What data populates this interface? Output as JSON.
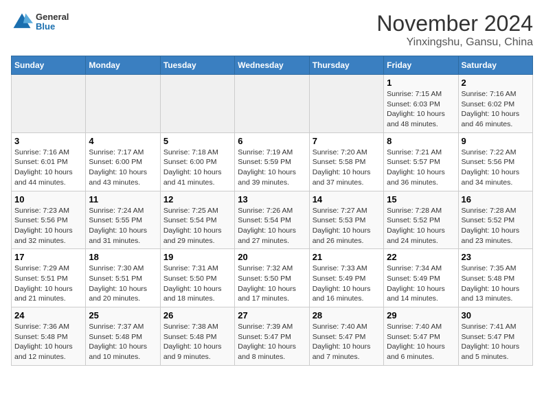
{
  "header": {
    "logo_general": "General",
    "logo_blue": "Blue",
    "title": "November 2024",
    "subtitle": "Yinxingshu, Gansu, China"
  },
  "weekdays": [
    "Sunday",
    "Monday",
    "Tuesday",
    "Wednesday",
    "Thursday",
    "Friday",
    "Saturday"
  ],
  "weeks": [
    [
      {
        "day": "",
        "info": ""
      },
      {
        "day": "",
        "info": ""
      },
      {
        "day": "",
        "info": ""
      },
      {
        "day": "",
        "info": ""
      },
      {
        "day": "",
        "info": ""
      },
      {
        "day": "1",
        "info": "Sunrise: 7:15 AM\nSunset: 6:03 PM\nDaylight: 10 hours and 48 minutes."
      },
      {
        "day": "2",
        "info": "Sunrise: 7:16 AM\nSunset: 6:02 PM\nDaylight: 10 hours and 46 minutes."
      }
    ],
    [
      {
        "day": "3",
        "info": "Sunrise: 7:16 AM\nSunset: 6:01 PM\nDaylight: 10 hours and 44 minutes."
      },
      {
        "day": "4",
        "info": "Sunrise: 7:17 AM\nSunset: 6:00 PM\nDaylight: 10 hours and 43 minutes."
      },
      {
        "day": "5",
        "info": "Sunrise: 7:18 AM\nSunset: 6:00 PM\nDaylight: 10 hours and 41 minutes."
      },
      {
        "day": "6",
        "info": "Sunrise: 7:19 AM\nSunset: 5:59 PM\nDaylight: 10 hours and 39 minutes."
      },
      {
        "day": "7",
        "info": "Sunrise: 7:20 AM\nSunset: 5:58 PM\nDaylight: 10 hours and 37 minutes."
      },
      {
        "day": "8",
        "info": "Sunrise: 7:21 AM\nSunset: 5:57 PM\nDaylight: 10 hours and 36 minutes."
      },
      {
        "day": "9",
        "info": "Sunrise: 7:22 AM\nSunset: 5:56 PM\nDaylight: 10 hours and 34 minutes."
      }
    ],
    [
      {
        "day": "10",
        "info": "Sunrise: 7:23 AM\nSunset: 5:56 PM\nDaylight: 10 hours and 32 minutes."
      },
      {
        "day": "11",
        "info": "Sunrise: 7:24 AM\nSunset: 5:55 PM\nDaylight: 10 hours and 31 minutes."
      },
      {
        "day": "12",
        "info": "Sunrise: 7:25 AM\nSunset: 5:54 PM\nDaylight: 10 hours and 29 minutes."
      },
      {
        "day": "13",
        "info": "Sunrise: 7:26 AM\nSunset: 5:54 PM\nDaylight: 10 hours and 27 minutes."
      },
      {
        "day": "14",
        "info": "Sunrise: 7:27 AM\nSunset: 5:53 PM\nDaylight: 10 hours and 26 minutes."
      },
      {
        "day": "15",
        "info": "Sunrise: 7:28 AM\nSunset: 5:52 PM\nDaylight: 10 hours and 24 minutes."
      },
      {
        "day": "16",
        "info": "Sunrise: 7:28 AM\nSunset: 5:52 PM\nDaylight: 10 hours and 23 minutes."
      }
    ],
    [
      {
        "day": "17",
        "info": "Sunrise: 7:29 AM\nSunset: 5:51 PM\nDaylight: 10 hours and 21 minutes."
      },
      {
        "day": "18",
        "info": "Sunrise: 7:30 AM\nSunset: 5:51 PM\nDaylight: 10 hours and 20 minutes."
      },
      {
        "day": "19",
        "info": "Sunrise: 7:31 AM\nSunset: 5:50 PM\nDaylight: 10 hours and 18 minutes."
      },
      {
        "day": "20",
        "info": "Sunrise: 7:32 AM\nSunset: 5:50 PM\nDaylight: 10 hours and 17 minutes."
      },
      {
        "day": "21",
        "info": "Sunrise: 7:33 AM\nSunset: 5:49 PM\nDaylight: 10 hours and 16 minutes."
      },
      {
        "day": "22",
        "info": "Sunrise: 7:34 AM\nSunset: 5:49 PM\nDaylight: 10 hours and 14 minutes."
      },
      {
        "day": "23",
        "info": "Sunrise: 7:35 AM\nSunset: 5:48 PM\nDaylight: 10 hours and 13 minutes."
      }
    ],
    [
      {
        "day": "24",
        "info": "Sunrise: 7:36 AM\nSunset: 5:48 PM\nDaylight: 10 hours and 12 minutes."
      },
      {
        "day": "25",
        "info": "Sunrise: 7:37 AM\nSunset: 5:48 PM\nDaylight: 10 hours and 10 minutes."
      },
      {
        "day": "26",
        "info": "Sunrise: 7:38 AM\nSunset: 5:48 PM\nDaylight: 10 hours and 9 minutes."
      },
      {
        "day": "27",
        "info": "Sunrise: 7:39 AM\nSunset: 5:47 PM\nDaylight: 10 hours and 8 minutes."
      },
      {
        "day": "28",
        "info": "Sunrise: 7:40 AM\nSunset: 5:47 PM\nDaylight: 10 hours and 7 minutes."
      },
      {
        "day": "29",
        "info": "Sunrise: 7:40 AM\nSunset: 5:47 PM\nDaylight: 10 hours and 6 minutes."
      },
      {
        "day": "30",
        "info": "Sunrise: 7:41 AM\nSunset: 5:47 PM\nDaylight: 10 hours and 5 minutes."
      }
    ]
  ]
}
